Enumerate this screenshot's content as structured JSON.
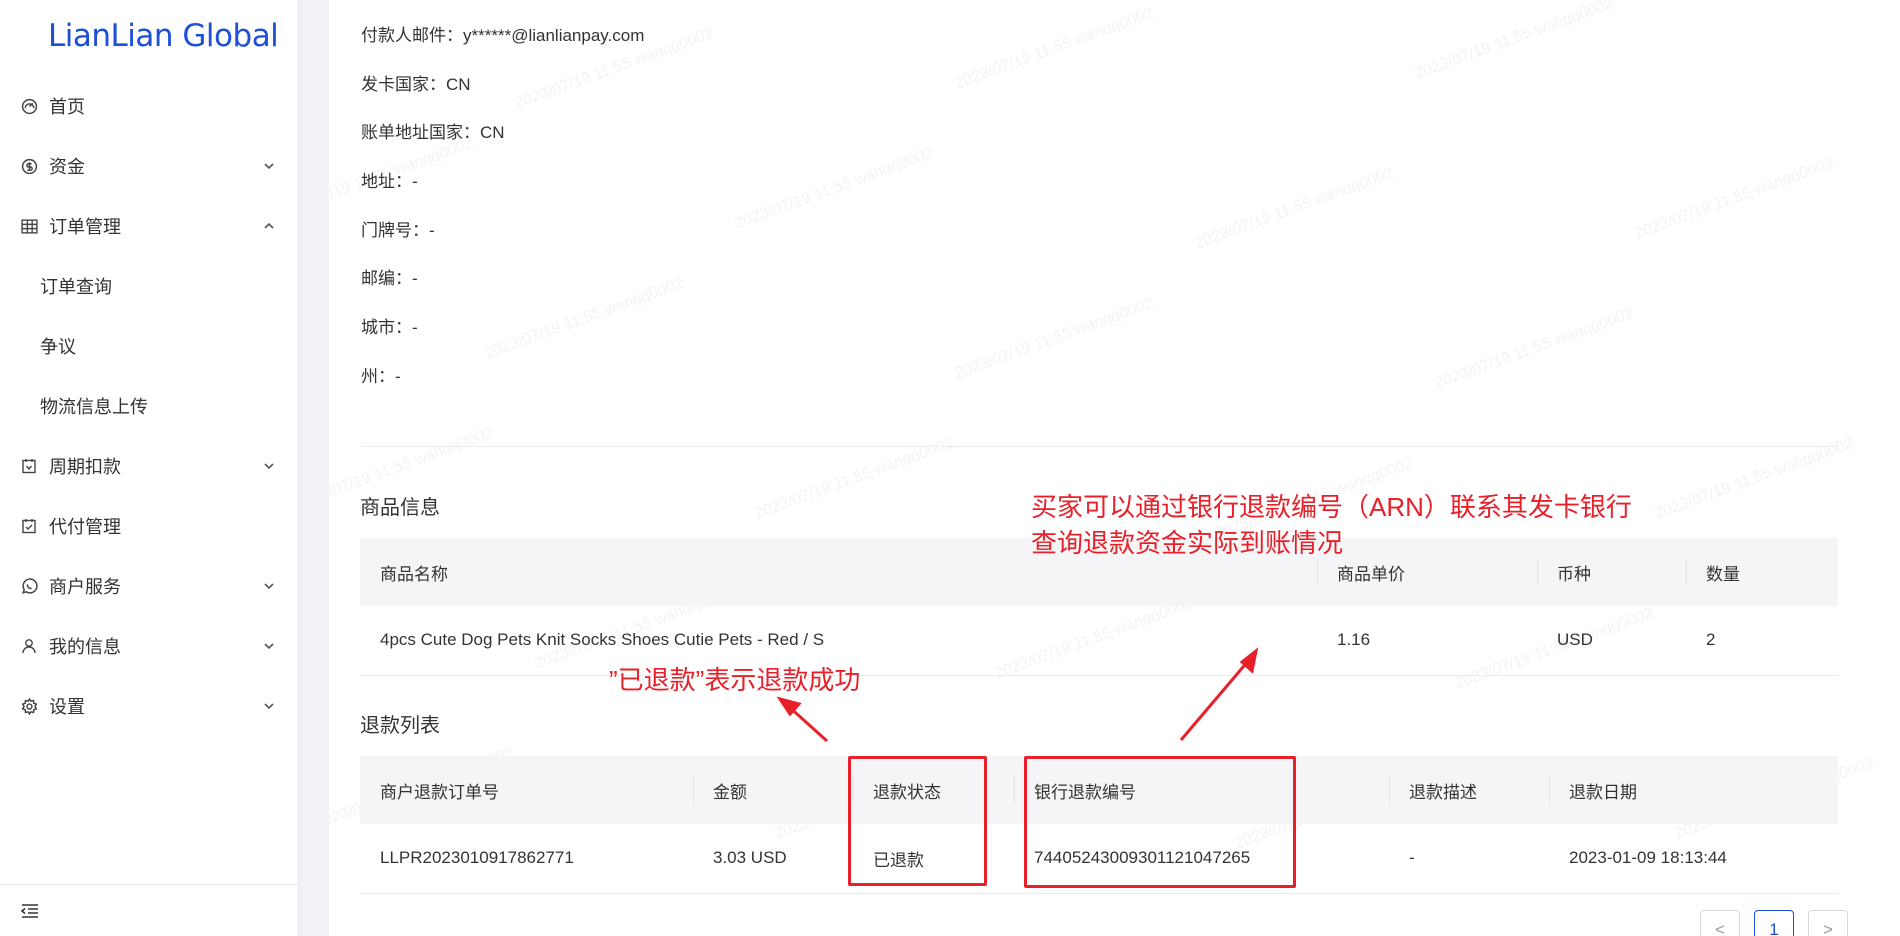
{
  "app": {
    "logo": "LianLian Global"
  },
  "sidebar": {
    "items": [
      {
        "label": "首页",
        "icon": "dashboard-icon",
        "arrow": ""
      },
      {
        "label": "资金",
        "icon": "dollar-icon",
        "arrow": "down"
      },
      {
        "label": "订单管理",
        "icon": "table-icon",
        "arrow": "up"
      },
      {
        "label": "订单查询",
        "sub": true
      },
      {
        "label": "争议",
        "sub": true
      },
      {
        "label": "物流信息上传",
        "sub": true
      },
      {
        "label": "周期扣款",
        "icon": "calendar-icon",
        "arrow": "down"
      },
      {
        "label": "代付管理",
        "icon": "calendar-check-icon",
        "arrow": ""
      },
      {
        "label": "商户服务",
        "icon": "whatsapp-icon",
        "arrow": "down"
      },
      {
        "label": "我的信息",
        "icon": "user-icon",
        "arrow": "down"
      },
      {
        "label": "设置",
        "icon": "gear-icon",
        "arrow": "down"
      }
    ]
  },
  "payer": {
    "email": "付款人邮件：y******@lianlianpay.com",
    "card_country": "发卡国家：CN",
    "billing_country": "账单地址国家：CN",
    "address": "地址：-",
    "house_no": "门牌号：-",
    "postcode": "邮编：-",
    "city": "城市：-",
    "state": "州：-"
  },
  "products": {
    "title": "商品信息",
    "headers": [
      "商品名称",
      "商品单价",
      "币种",
      "数量"
    ],
    "rows": [
      [
        "4pcs Cute Dog Pets Knit Socks Shoes Cutie Pets - Red / S",
        "1.16",
        "USD",
        "2"
      ]
    ]
  },
  "refunds": {
    "title": "退款列表",
    "headers": [
      "商户退款订单号",
      "金额",
      "退款状态",
      "银行退款编号",
      "退款描述",
      "退款日期"
    ],
    "rows": [
      [
        "LLPR2023010917862771",
        "3.03 USD",
        "已退款",
        "74405243009301121047265",
        "-",
        "2023-01-09 18:13:44"
      ]
    ]
  },
  "annotations": {
    "arn_line1": "买家可以通过银行退款编号（ARN）联系其发卡银行",
    "arn_line2": "查询退款资金实际到账情况",
    "status_note": "”已退款”表示退款成功",
    "color": "#e8202a"
  },
  "pagination": {
    "prev": "<",
    "current": "1",
    "next": ">"
  },
  "colors": {
    "brand": "#1d4fd8",
    "annotation": "#e8202a"
  }
}
